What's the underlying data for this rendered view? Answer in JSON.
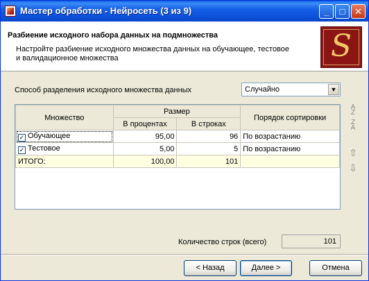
{
  "window": {
    "title": "Мастер обработки - Нейросеть (3 из 9)",
    "controls": {
      "minimize": "_",
      "maximize": "□",
      "close": "✕"
    }
  },
  "header": {
    "title": "Разбиение исходного набора данных на подмножества",
    "description": "Настройте разбиение исходного множества данных на обучающее, тестовое и валидационное множества",
    "logo_text": "S"
  },
  "split_method": {
    "label": "Способ разделения исходного множества данных",
    "value": "Случайно",
    "arrow": "▼"
  },
  "table": {
    "headers": {
      "set": "Множество",
      "size": "Размер",
      "percent": "В процентах",
      "rows": "В строках",
      "sort": "Порядок сортировки"
    },
    "rows": [
      {
        "name": "Обучающее",
        "checked": true,
        "percent": "95,00",
        "rows": "96",
        "sort": "По возрастанию"
      },
      {
        "name": "Тестовое",
        "checked": true,
        "percent": "5,00",
        "rows": "5",
        "sort": "По возрастанию"
      }
    ],
    "total": {
      "label": "ИТОГО:",
      "percent": "100,00",
      "rows": "101",
      "sort": ""
    }
  },
  "side_icons": {
    "sort_asc": "A\nZ",
    "sort_desc": "Z\nA",
    "move_up": "⇧",
    "move_down": "⇩"
  },
  "count": {
    "label": "Количество строк (всего)",
    "value": "101"
  },
  "buttons": {
    "back": "< Назад",
    "next": "Далее >",
    "cancel": "Отмена"
  }
}
